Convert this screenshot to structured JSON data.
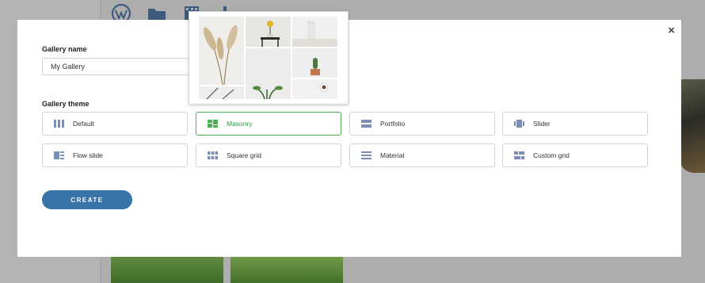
{
  "background": {
    "toolbar_icons": [
      "wordpress-icon",
      "folder-icon",
      "film-icon",
      "music-icon"
    ]
  },
  "modal": {
    "close_label": "×",
    "gallery_name_label": "Gallery name",
    "gallery_name_value": "My Gallery",
    "gallery_theme_label": "Gallery theme",
    "themes": [
      {
        "label": "Default",
        "icon": "columns-icon",
        "selected": false
      },
      {
        "label": "Masonry",
        "icon": "masonry-icon",
        "selected": true
      },
      {
        "label": "Portfolio",
        "icon": "portfolio-icon",
        "selected": false
      },
      {
        "label": "Slider",
        "icon": "slider-icon",
        "selected": false
      },
      {
        "label": "Flow slide",
        "icon": "flow-slide-icon",
        "selected": false
      },
      {
        "label": "Square grid",
        "icon": "square-grid-icon",
        "selected": false
      },
      {
        "label": "Material",
        "icon": "material-icon",
        "selected": false
      },
      {
        "label": "Custom grid",
        "icon": "custom-grid-icon",
        "selected": false
      }
    ],
    "create_label": "CREATE",
    "selected_check": "✓"
  },
  "colors": {
    "accent_green": "#4caf50",
    "button_blue": "#3874aa",
    "icon_slate": "#7b8fb6"
  }
}
